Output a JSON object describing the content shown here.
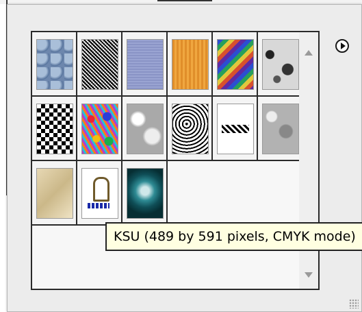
{
  "tooltip": {
    "text": "KSU (489 by 591 pixels, CMYK mode)"
  },
  "swatches": [
    {
      "name": "bubbles"
    },
    {
      "name": "noise"
    },
    {
      "name": "blue"
    },
    {
      "name": "orange"
    },
    {
      "name": "rainbow"
    },
    {
      "name": "marble"
    },
    {
      "name": "checker"
    },
    {
      "name": "confetti"
    },
    {
      "name": "cloudy"
    },
    {
      "name": "swirl"
    },
    {
      "name": "zigzag"
    },
    {
      "name": "granite"
    },
    {
      "name": "sand"
    },
    {
      "name": "logo"
    },
    {
      "name": "KSU"
    }
  ],
  "icons": {
    "panel_menu": "circle-right-arrow-icon",
    "scroll_up": "triangle-up-icon",
    "scroll_down": "triangle-down-icon",
    "resize_grip": "resize-grip-icon"
  },
  "colors": {
    "tooltip_bg": "#ffffe1",
    "panel_bg": "#ececec",
    "grid_bg": "#f7f7f7"
  }
}
